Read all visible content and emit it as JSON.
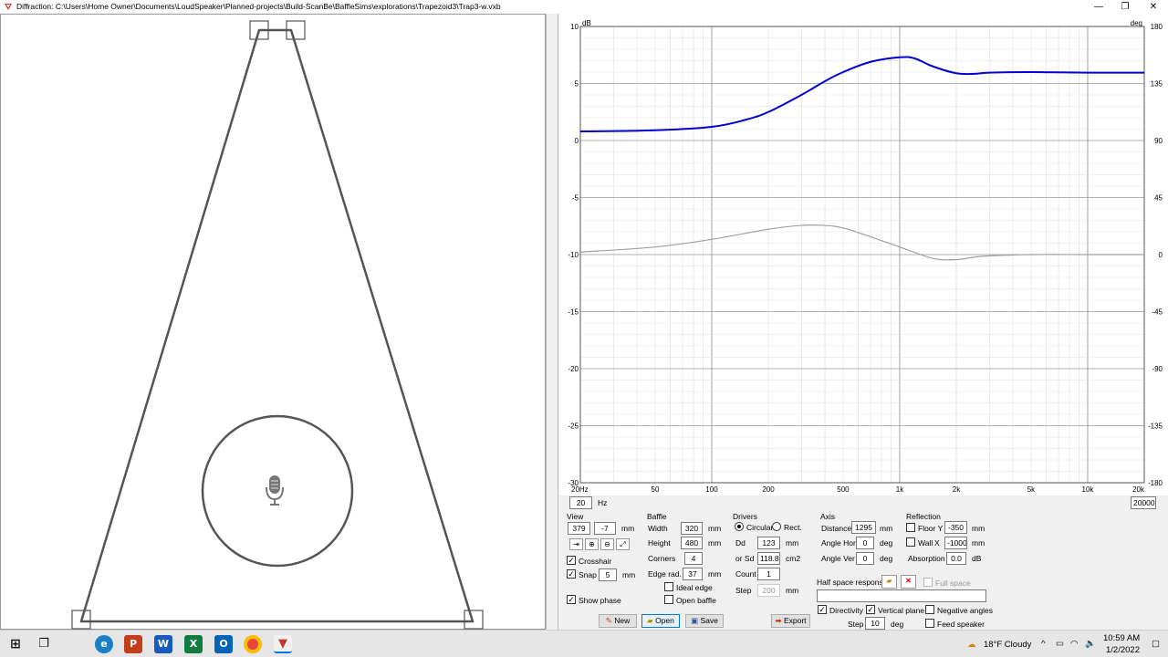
{
  "window": {
    "title": "Diffraction: C:\\Users\\Home Owner\\Documents\\LoudSpeaker\\Planned-projects\\Build-ScanBe\\BaffleSims\\explorations\\Trapezoid3\\Trap3-w.vxb",
    "minimize": "—",
    "restore": "❐",
    "close": "✕"
  },
  "colors": {
    "magnitude": "#0000d0",
    "phase": "#a0a0a0",
    "app_icon": "#c0392b"
  },
  "chart_data": {
    "type": "line",
    "x_scale": "log",
    "xlim": [
      20,
      20000
    ],
    "ylim_left": [
      -30,
      10
    ],
    "ylim_right": [
      -180,
      180
    ],
    "ylabel_left": "dB",
    "ylabel_right": "deg",
    "x_tick_labels": [
      "20Hz",
      "50",
      "100",
      "200",
      "500",
      "1k",
      "2k",
      "5k",
      "10k",
      "20k"
    ],
    "y_left_tick_labels": [
      "10",
      "5",
      "0",
      "-5",
      "-10",
      "-15",
      "-20",
      "-25",
      "-30"
    ],
    "y_right_tick_labels": [
      "180",
      "135",
      "90",
      "45",
      "0",
      "-45",
      "-90",
      "-135",
      "-180"
    ],
    "grid": true,
    "series": [
      {
        "axis": "left",
        "color": "#0000d0",
        "x": [
          20,
          50,
          100,
          150,
          200,
          300,
          400,
          500,
          700,
          1000,
          1200,
          1500,
          2000,
          2500,
          3000,
          5000,
          10000,
          20000
        ],
        "y": [
          0.8,
          0.9,
          1.2,
          1.8,
          2.5,
          4.0,
          5.2,
          6.0,
          6.9,
          7.3,
          7.2,
          6.5,
          5.9,
          5.85,
          5.95,
          6.0,
          5.95,
          5.95
        ]
      },
      {
        "axis": "right",
        "color": "#a0a0a0",
        "x": [
          20,
          50,
          100,
          200,
          300,
          400,
          500,
          700,
          1000,
          1500,
          2000,
          2500,
          3000,
          5000,
          10000,
          20000
        ],
        "y": [
          2,
          6,
          12,
          20,
          23,
          23,
          21,
          14,
          6,
          -3,
          -4,
          -2,
          -1,
          0,
          0,
          0
        ]
      }
    ]
  },
  "graph_bottom": {
    "freq_min": "20",
    "freq_unit": "Hz",
    "freq_max": "20000"
  },
  "view": {
    "title": "View",
    "x": "379",
    "y": "-7",
    "unit": "mm",
    "crosshair_label": "Crosshair",
    "crosshair": true,
    "snap_label": "Snap",
    "snap": true,
    "snap_value": "5",
    "snap_unit": "mm",
    "show_phase_label": "Show phase",
    "show_phase": true
  },
  "baffle": {
    "title": "Baffle",
    "width_label": "Width",
    "width": "320",
    "height_label": "Height",
    "height": "480",
    "corners_label": "Corners",
    "corners": "4",
    "edge_rad_label": "Edge rad.",
    "edge_rad": "37",
    "unit": "mm",
    "ideal_edge_label": "Ideal edge",
    "ideal_edge": false,
    "open_baffle_label": "Open baffle",
    "open_baffle": false
  },
  "drivers": {
    "title": "Drivers",
    "circular_label": "Circular",
    "rect_label": "Rect.",
    "shape": "circular",
    "dd_label": "Dd",
    "dd": "123",
    "dd_unit": "mm",
    "sd_label": "or Sd",
    "sd": "118.8",
    "sd_unit": "cm2",
    "count_label": "Count",
    "count": "1",
    "step_label": "Step",
    "step": "200",
    "step_unit": "mm"
  },
  "axis": {
    "title": "Axis",
    "distance_label": "Distance",
    "distance": "1295",
    "distance_unit": "mm",
    "angle_hor_label": "Angle Hor",
    "angle_hor": "0",
    "angle_ver_label": "Angle Ver",
    "angle_ver": "0",
    "deg": "deg"
  },
  "reflection": {
    "title": "Reflection",
    "floor_label": "Floor Y",
    "floor": false,
    "floor_value": "-350",
    "wall_label": "Wall",
    "wall_axis": "X",
    "wall": false,
    "wall_value": "-1000",
    "absorption_label": "Absorption",
    "absorption": "0.0",
    "absorption_unit": "dB",
    "unit": "mm"
  },
  "half_space": {
    "label": "Half space response",
    "full_space_label": "Full space",
    "full_space": false,
    "field": ""
  },
  "directivity": {
    "directivity_label": "Directivity",
    "directivity": true,
    "vertical_plane_label": "Vertical plane",
    "vertical_plane": true,
    "negative_angles_label": "Negative angles",
    "negative_angles": false,
    "feed_speaker_label": "Feed speaker",
    "feed_speaker": false,
    "step_label": "Step",
    "step": "10",
    "step_unit": "deg"
  },
  "buttons": {
    "new": "New",
    "open": "Open",
    "save": "Save",
    "export": "Export"
  },
  "taskbar": {
    "weather": "18°F  Cloudy",
    "time": "10:59 AM",
    "date": "1/2/2022",
    "apps": [
      "windows-start",
      "task-view",
      "edge",
      "powerpoint",
      "word",
      "excel",
      "outlook",
      "chrome",
      "diffraction-app"
    ]
  }
}
